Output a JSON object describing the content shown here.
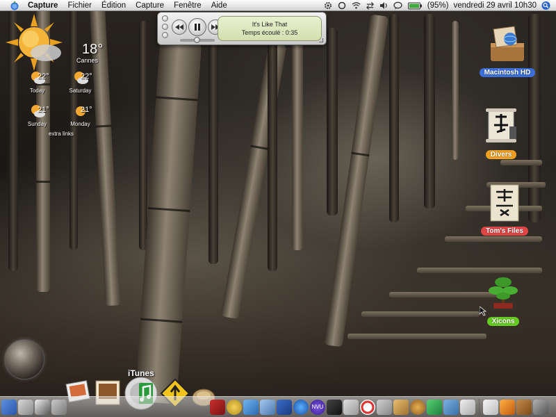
{
  "menubar": {
    "app_name": "Capture",
    "items": [
      "Fichier",
      "Édition",
      "Capture",
      "Fenêtre",
      "Aide"
    ],
    "battery": "(95%)",
    "clock": "vendredi 29 avril 10h30",
    "status_icons": [
      "gear-icon",
      "circle-icon",
      "wifi-icon",
      "dual-arrows-icon",
      "volume-icon",
      "chat-icon",
      "battery-icon",
      "spotlight-icon"
    ]
  },
  "weather": {
    "current_temp": "18°",
    "city": "Cannes",
    "forecast": [
      {
        "day": "Today",
        "temp": "22°"
      },
      {
        "day": "Saturday",
        "temp": "22°"
      },
      {
        "day": "Sunday",
        "temp": "21°"
      },
      {
        "day": "Monday",
        "temp": "21°"
      }
    ],
    "links": "extra links"
  },
  "itunes": {
    "song": "It's Like That",
    "elapsed": "Temps écoulé : 0:35"
  },
  "desktop_icons": [
    {
      "label": "Macintosh HD",
      "color": "#3b6fd9"
    },
    {
      "label": "Divers",
      "color": "#f0a020"
    },
    {
      "label": "Tom's Files",
      "color": "#e04545"
    },
    {
      "label": "Xicons",
      "color": "#66cc22"
    }
  ],
  "dock": {
    "tooltip": "iTunes"
  }
}
